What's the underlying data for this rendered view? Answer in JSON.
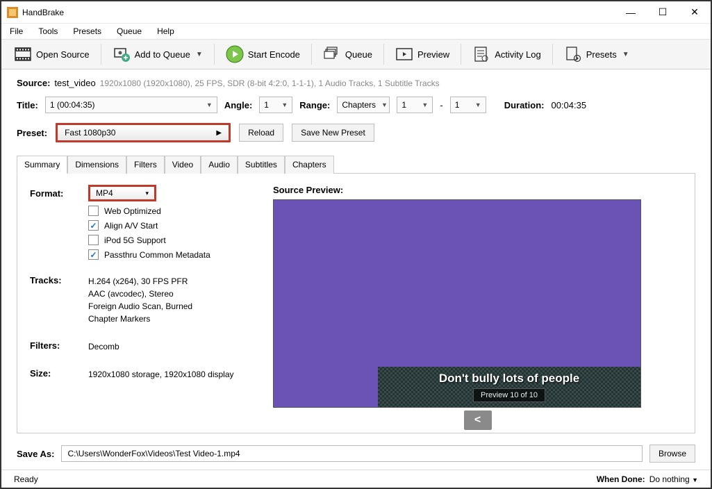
{
  "window": {
    "title": "HandBrake"
  },
  "menu": [
    "File",
    "Tools",
    "Presets",
    "Queue",
    "Help"
  ],
  "toolbar": {
    "open_source": "Open Source",
    "add_queue": "Add to Queue",
    "start_encode": "Start Encode",
    "queue": "Queue",
    "preview": "Preview",
    "activity_log": "Activity Log",
    "presets": "Presets"
  },
  "source": {
    "label": "Source:",
    "name": "test_video",
    "info": "1920x1080 (1920x1080), 25 FPS, SDR (8-bit 4:2:0, 1-1-1), 1 Audio Tracks, 1 Subtitle Tracks"
  },
  "title_row": {
    "title_label": "Title:",
    "title_value": "1  (00:04:35)",
    "angle_label": "Angle:",
    "angle_value": "1",
    "range_label": "Range:",
    "range_value": "Chapters",
    "chap_from": "1",
    "dash": "-",
    "chap_to": "1",
    "duration_label": "Duration:",
    "duration_value": "00:04:35"
  },
  "preset": {
    "label": "Preset:",
    "value": "Fast 1080p30",
    "reload": "Reload",
    "save_new": "Save New Preset"
  },
  "tabs": [
    "Summary",
    "Dimensions",
    "Filters",
    "Video",
    "Audio",
    "Subtitles",
    "Chapters"
  ],
  "summary": {
    "format_label": "Format:",
    "format_value": "MP4",
    "opts": {
      "web": "Web Optimized",
      "align": "Align A/V Start",
      "ipod": "iPod 5G Support",
      "passthru": "Passthru Common Metadata"
    },
    "tracks_label": "Tracks:",
    "tracks": [
      "H.264 (x264), 30 FPS PFR",
      "AAC (avcodec), Stereo",
      "Foreign Audio Scan, Burned",
      "Chapter Markers"
    ],
    "filters_label": "Filters:",
    "filters_value": "Decomb",
    "size_label": "Size:",
    "size_value": "1920x1080 storage, 1920x1080 display",
    "preview_label": "Source Preview:",
    "subtitle_text": "Don't bully lots of people",
    "preview_badge": "Preview 10 of 10",
    "nav_prev": "<"
  },
  "saveas": {
    "label": "Save As:",
    "path": "C:\\Users\\WonderFox\\Videos\\Test Video-1.mp4",
    "browse": "Browse"
  },
  "status": {
    "ready": "Ready",
    "when_done_label": "When Done:",
    "when_done_value": "Do nothing"
  }
}
